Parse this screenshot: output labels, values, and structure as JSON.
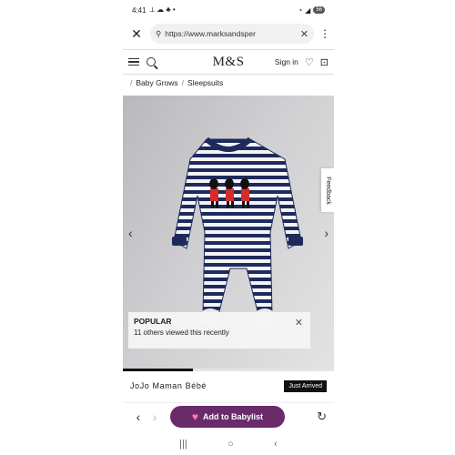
{
  "status": {
    "time": "4:41",
    "battery": "56"
  },
  "browser": {
    "url": "https://www.marksandsper"
  },
  "site": {
    "logo": "M&S",
    "signin": "Sign in"
  },
  "breadcrumb": [
    "Baby Grows",
    "Sleepsuits"
  ],
  "popular": {
    "title": "POPULAR",
    "text": "11 others viewed this recently"
  },
  "feedback": "Feedback",
  "gallery": {
    "progress": 0.33
  },
  "product": {
    "brand": "JoJo Maman Bébé",
    "badge": "Just Arrived"
  },
  "toolbar": {
    "cta": "Add to Babylist"
  },
  "colors": {
    "navy": "#1f2a5c",
    "cta": "#6a2b6b",
    "red": "#d92b2b"
  }
}
